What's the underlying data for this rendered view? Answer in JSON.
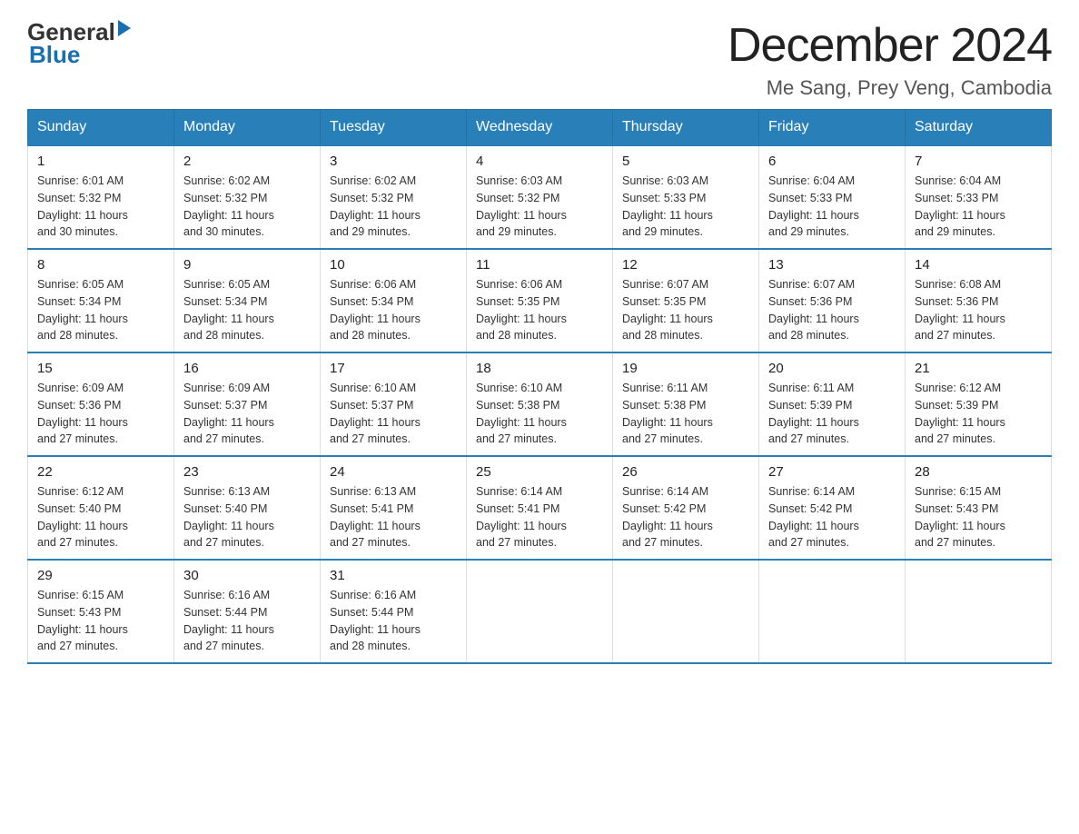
{
  "header": {
    "month_title": "December 2024",
    "location": "Me Sang, Prey Veng, Cambodia",
    "logo_general": "General",
    "logo_blue": "Blue"
  },
  "columns": [
    "Sunday",
    "Monday",
    "Tuesday",
    "Wednesday",
    "Thursday",
    "Friday",
    "Saturday"
  ],
  "weeks": [
    [
      {
        "day": "1",
        "sunrise": "6:01 AM",
        "sunset": "5:32 PM",
        "daylight": "11 hours and 30 minutes."
      },
      {
        "day": "2",
        "sunrise": "6:02 AM",
        "sunset": "5:32 PM",
        "daylight": "11 hours and 30 minutes."
      },
      {
        "day": "3",
        "sunrise": "6:02 AM",
        "sunset": "5:32 PM",
        "daylight": "11 hours and 29 minutes."
      },
      {
        "day": "4",
        "sunrise": "6:03 AM",
        "sunset": "5:32 PM",
        "daylight": "11 hours and 29 minutes."
      },
      {
        "day": "5",
        "sunrise": "6:03 AM",
        "sunset": "5:33 PM",
        "daylight": "11 hours and 29 minutes."
      },
      {
        "day": "6",
        "sunrise": "6:04 AM",
        "sunset": "5:33 PM",
        "daylight": "11 hours and 29 minutes."
      },
      {
        "day": "7",
        "sunrise": "6:04 AM",
        "sunset": "5:33 PM",
        "daylight": "11 hours and 29 minutes."
      }
    ],
    [
      {
        "day": "8",
        "sunrise": "6:05 AM",
        "sunset": "5:34 PM",
        "daylight": "11 hours and 28 minutes."
      },
      {
        "day": "9",
        "sunrise": "6:05 AM",
        "sunset": "5:34 PM",
        "daylight": "11 hours and 28 minutes."
      },
      {
        "day": "10",
        "sunrise": "6:06 AM",
        "sunset": "5:34 PM",
        "daylight": "11 hours and 28 minutes."
      },
      {
        "day": "11",
        "sunrise": "6:06 AM",
        "sunset": "5:35 PM",
        "daylight": "11 hours and 28 minutes."
      },
      {
        "day": "12",
        "sunrise": "6:07 AM",
        "sunset": "5:35 PM",
        "daylight": "11 hours and 28 minutes."
      },
      {
        "day": "13",
        "sunrise": "6:07 AM",
        "sunset": "5:36 PM",
        "daylight": "11 hours and 28 minutes."
      },
      {
        "day": "14",
        "sunrise": "6:08 AM",
        "sunset": "5:36 PM",
        "daylight": "11 hours and 27 minutes."
      }
    ],
    [
      {
        "day": "15",
        "sunrise": "6:09 AM",
        "sunset": "5:36 PM",
        "daylight": "11 hours and 27 minutes."
      },
      {
        "day": "16",
        "sunrise": "6:09 AM",
        "sunset": "5:37 PM",
        "daylight": "11 hours and 27 minutes."
      },
      {
        "day": "17",
        "sunrise": "6:10 AM",
        "sunset": "5:37 PM",
        "daylight": "11 hours and 27 minutes."
      },
      {
        "day": "18",
        "sunrise": "6:10 AM",
        "sunset": "5:38 PM",
        "daylight": "11 hours and 27 minutes."
      },
      {
        "day": "19",
        "sunrise": "6:11 AM",
        "sunset": "5:38 PM",
        "daylight": "11 hours and 27 minutes."
      },
      {
        "day": "20",
        "sunrise": "6:11 AM",
        "sunset": "5:39 PM",
        "daylight": "11 hours and 27 minutes."
      },
      {
        "day": "21",
        "sunrise": "6:12 AM",
        "sunset": "5:39 PM",
        "daylight": "11 hours and 27 minutes."
      }
    ],
    [
      {
        "day": "22",
        "sunrise": "6:12 AM",
        "sunset": "5:40 PM",
        "daylight": "11 hours and 27 minutes."
      },
      {
        "day": "23",
        "sunrise": "6:13 AM",
        "sunset": "5:40 PM",
        "daylight": "11 hours and 27 minutes."
      },
      {
        "day": "24",
        "sunrise": "6:13 AM",
        "sunset": "5:41 PM",
        "daylight": "11 hours and 27 minutes."
      },
      {
        "day": "25",
        "sunrise": "6:14 AM",
        "sunset": "5:41 PM",
        "daylight": "11 hours and 27 minutes."
      },
      {
        "day": "26",
        "sunrise": "6:14 AM",
        "sunset": "5:42 PM",
        "daylight": "11 hours and 27 minutes."
      },
      {
        "day": "27",
        "sunrise": "6:14 AM",
        "sunset": "5:42 PM",
        "daylight": "11 hours and 27 minutes."
      },
      {
        "day": "28",
        "sunrise": "6:15 AM",
        "sunset": "5:43 PM",
        "daylight": "11 hours and 27 minutes."
      }
    ],
    [
      {
        "day": "29",
        "sunrise": "6:15 AM",
        "sunset": "5:43 PM",
        "daylight": "11 hours and 27 minutes."
      },
      {
        "day": "30",
        "sunrise": "6:16 AM",
        "sunset": "5:44 PM",
        "daylight": "11 hours and 27 minutes."
      },
      {
        "day": "31",
        "sunrise": "6:16 AM",
        "sunset": "5:44 PM",
        "daylight": "11 hours and 28 minutes."
      },
      null,
      null,
      null,
      null
    ]
  ],
  "labels": {
    "sunrise": "Sunrise:",
    "sunset": "Sunset:",
    "daylight": "Daylight:"
  }
}
